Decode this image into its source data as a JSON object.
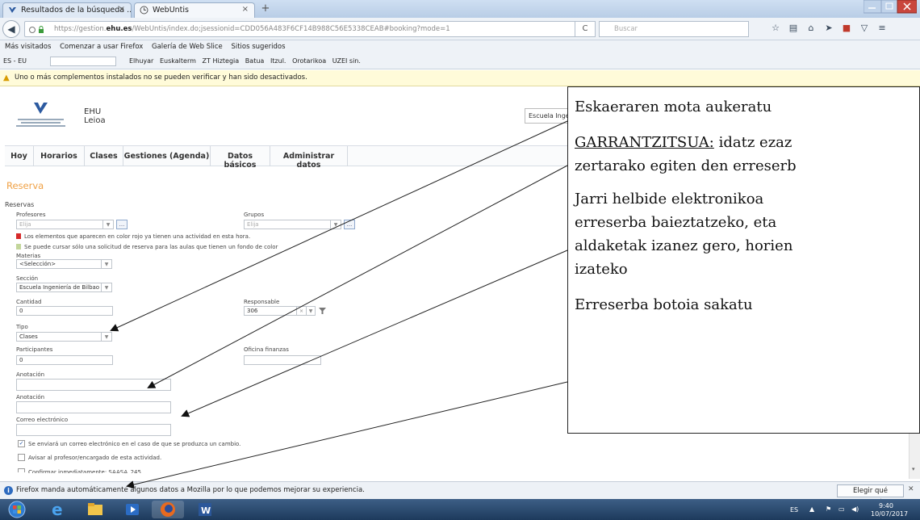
{
  "browser": {
    "tabs": [
      {
        "label": "Resultados de la búsqueda ..."
      },
      {
        "label": "WebUntis"
      }
    ],
    "url_prefix": "https://gestion.",
    "url_domain": "ehu.es",
    "url_rest": "/WebUntis/index.do;jsessionid=CDD056A483F6CF14B988C56E5338CEAB#booking?mode=1",
    "search_placeholder": "Buscar",
    "bookmarks": [
      "Más visitados",
      "Comenzar a usar Firefox",
      "Galería de Web Slice",
      "Sitios sugeridos"
    ],
    "lang_selector": "ES - EU",
    "lang_links": [
      "Elhuyar",
      "Euskalterm",
      "ZT Hiztegia",
      "Batua",
      "Itzul.",
      "Orotarikoa",
      "UZEI sin."
    ],
    "addon_warning": "Uno o más complementos instalados no se pueden verificar y han sido desactivados."
  },
  "header": {
    "org_line1": "EHU",
    "org_line2": "Leioa",
    "school": "Escuela Ingen"
  },
  "menu": [
    "Hoy",
    "Horarios",
    "Clases",
    "Gestiones (Agenda)",
    "Datos básicos",
    "Administrar datos"
  ],
  "form": {
    "title": "Reserva",
    "section": "Reservas",
    "profesores_label": "Profesores",
    "profesores_placeholder": "Elija",
    "grupos_label": "Grupos",
    "grupos_placeholder": "Elija",
    "legend_red": "Los elementos que aparecen en color rojo ya tienen una actividad en esta hora.",
    "legend_green": "Se puede cursar sólo una solicitud de reserva para las aulas que tienen un fondo de color",
    "materias_label": "Materias",
    "materias_value": "<Selección>",
    "seccion_label": "Sección",
    "seccion_value": "Escuela Ingeniería de Bilbao",
    "cantidad_label": "Cantidad",
    "cantidad_value": "0",
    "responsable_label": "Responsable",
    "responsable_value": "306",
    "tipo_label": "Tipo",
    "tipo_value": "Clases",
    "participantes_label": "Participantes",
    "participantes_value": "0",
    "oficina_label": "Oficina finanzas",
    "anotacion1_label": "Anotación",
    "anotacion2_label": "Anotación",
    "correo_label": "Correo electrónico",
    "check_email": "Se enviará un correo electrónico en el caso de que se produzca un cambio.",
    "check_avisar": "Avisar al profesor/encargado de esta actividad.",
    "check_confirm": "Confirmar inmediatamente: SAASA_245"
  },
  "callout": {
    "line1": "Eskaeraren mota aukeratu",
    "line2a": "GARRANTZITSUA:",
    "line2b": " idatz ezaz",
    "line3": "zertarako egiten den erreserb",
    "line4": "Jarri helbide elektronikoa",
    "line5": "erreserba baieztatzeko, eta",
    "line6": "aldaketak izanez gero, horien",
    "line7": "izateko",
    "line8": "Erreserba botoia sakatu"
  },
  "firefox_bar": {
    "message": "Firefox manda automáticamente algunos datos a Mozilla por lo que podemos mejorar su experiencia.",
    "button": "Elegir qué comparto"
  },
  "taskbar": {
    "lang": "ES",
    "time": "9:40",
    "date": "10/07/2017"
  }
}
